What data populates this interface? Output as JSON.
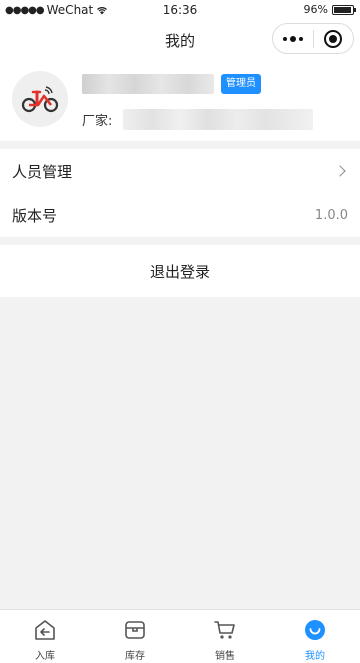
{
  "status_bar": {
    "signal_dots": "●●●●●",
    "carrier": "WeChat",
    "time": "16:36",
    "battery": "96%",
    "battery_level": 0.96
  },
  "nav": {
    "title": "我的"
  },
  "profile": {
    "role_badge": "管理员",
    "vendor_label": "厂家:"
  },
  "menu": {
    "items": [
      {
        "label": "人员管理"
      },
      {
        "label": "版本号",
        "value": "1.0.0"
      }
    ]
  },
  "logout": {
    "label": "退出登录"
  },
  "tabbar": {
    "tabs": [
      {
        "label": "入库",
        "icon": "inbound-icon"
      },
      {
        "label": "库存",
        "icon": "box-icon"
      },
      {
        "label": "销售",
        "icon": "cart-icon"
      },
      {
        "label": "我的",
        "icon": "profile-icon"
      }
    ],
    "active_index": 3
  },
  "colors": {
    "accent": "#1e90ff",
    "background": "#f2f2f2",
    "brand_red": "#e3322b"
  }
}
